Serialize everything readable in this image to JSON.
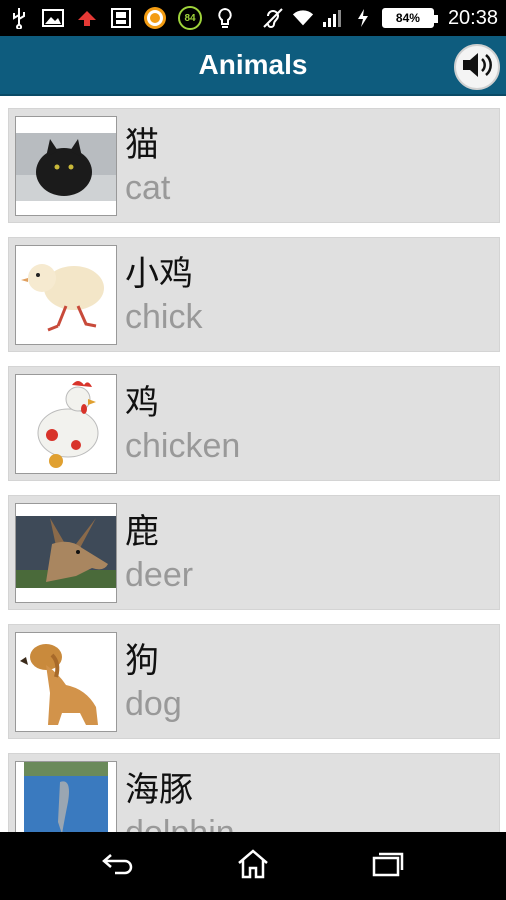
{
  "status_bar": {
    "time": "20:38",
    "battery": "84%",
    "badge": "84",
    "icons": [
      "usb-icon",
      "image-icon",
      "airplane-icon",
      "sd-card-icon",
      "orange-app-icon",
      "badge-84-icon",
      "lightbulb-icon",
      "hearing-icon",
      "wifi-icon",
      "signal-icon",
      "charging-icon",
      "battery-icon"
    ]
  },
  "header": {
    "title": "Animals",
    "sound_icon": "speaker-icon"
  },
  "items": [
    {
      "word": "猫",
      "translation": "cat"
    },
    {
      "word": "小鸡",
      "translation": "chick"
    },
    {
      "word": "鸡",
      "translation": "chicken"
    },
    {
      "word": "鹿",
      "translation": "deer"
    },
    {
      "word": "狗",
      "translation": "dog"
    },
    {
      "word": "海豚",
      "translation": "dolphin"
    }
  ],
  "nav": {
    "icons": [
      "back-icon",
      "home-icon",
      "recents-icon"
    ]
  },
  "colors": {
    "titlebar": "#0e5c7e",
    "item_bg": "#e0e0e0",
    "translation_text": "#999999"
  }
}
